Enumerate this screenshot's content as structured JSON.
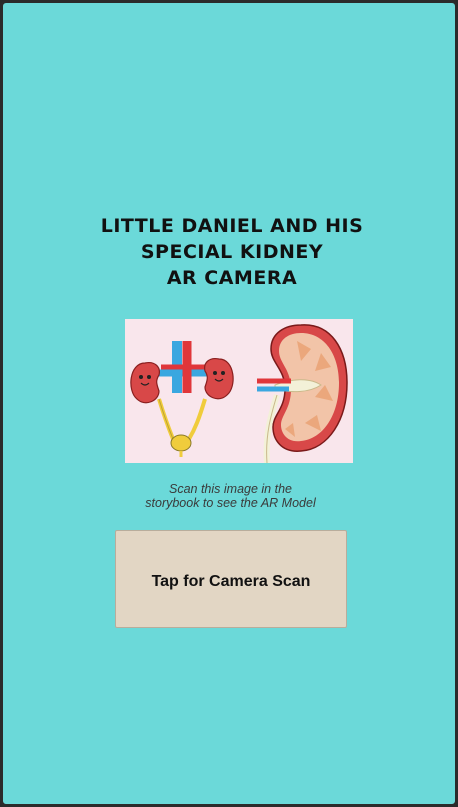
{
  "title_lines": [
    "Little Daniel and his",
    "special kidney",
    "AR Camera"
  ],
  "marker_image": {
    "icon": "kidney-illustration",
    "background": "#f9e6ec"
  },
  "hint_lines": [
    "Scan this image in the",
    "storybook to see the AR Model"
  ],
  "scan_button": {
    "label": "Tap for Camera Scan"
  },
  "colors": {
    "background": "#6bd9d9",
    "button": "#e2d6c4",
    "kidney_red": "#d84848",
    "artery_red": "#e0363a",
    "vein_blue": "#3aa7e0",
    "ureter_yellow": "#f0cc3c"
  }
}
